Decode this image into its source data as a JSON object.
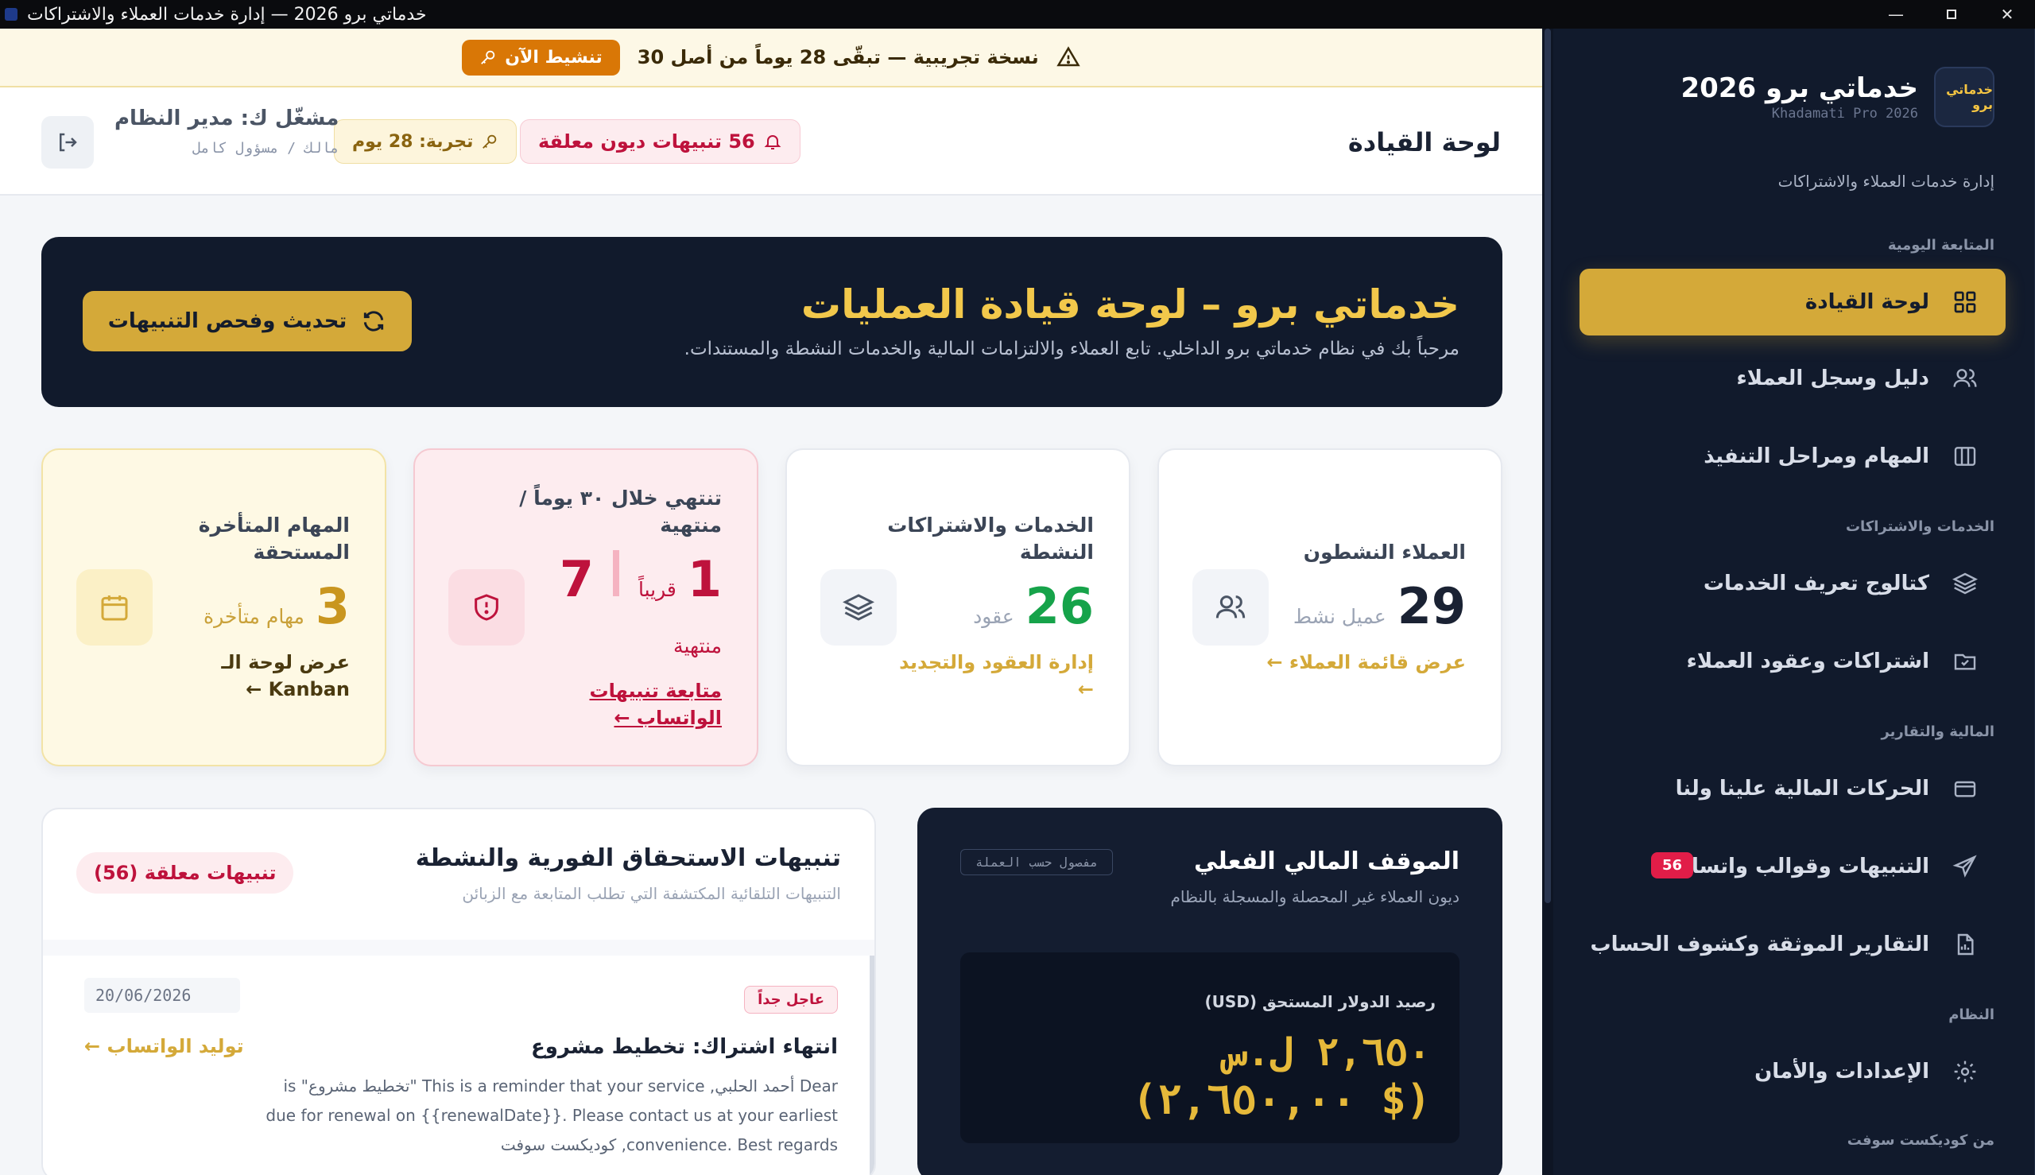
{
  "window": {
    "title": "خدماتي برو 2026 — إدارة خدمات العملاء والاشتراكات",
    "minimize": "—",
    "close": "✕"
  },
  "trial_banner": {
    "text": "نسخة تجريبية — تبقّى 28 يوماً من أصل 30",
    "button": "تنشيط الآن"
  },
  "header": {
    "page_title": "لوحة القيادة",
    "alerts_pill": "56 تنبيهات ديون معلقة",
    "trial_pill": "تجربة: 28 يوم",
    "user_name": "مشغّل ك: مدير النظام",
    "user_role": "مالك / مسؤول كامل"
  },
  "sidebar": {
    "brand_name": "خدماتي برو 2026",
    "brand_en": "Khadamati Pro 2026",
    "brand_logo_text": "خدماتي برو",
    "brand_sub": "إدارة خدمات العملاء والاشتراكات",
    "sections": {
      "daily": "المتابعة اليومية",
      "services": "الخدمات والاشتراكات",
      "finance": "المالية والتقارير",
      "system": "النظام",
      "vendor": "من كوديكست سوفت"
    },
    "items": {
      "dashboard": "لوحة القيادة",
      "customers": "دليل وسجل العملاء",
      "tasks": "المهام ومراحل التنفيذ",
      "catalog": "كتالوج تعريف الخدمات",
      "subscriptions": "اشتراكات وعقود العملاء",
      "transactions": "الحركات المالية علينا ولنا",
      "notifications": "التنبيهات وقوالب واتساب",
      "notifications_badge": "56",
      "reports": "التقارير الموثقة وكشوف الحساب",
      "settings": "الإعدادات والأمان"
    }
  },
  "hero": {
    "title": "خدماتي برو – لوحة قيادة العمليات",
    "subtitle": "مرحباً بك في نظام خدماتي برو الداخلي. تابع العملاء والالتزامات المالية والخدمات النشطة والمستندات.",
    "refresh_button": "تحديث وفحص التنبيهات"
  },
  "stats": {
    "active_customers": {
      "title": "العملاء النشطون",
      "value": "29",
      "unit": "عميل نشط",
      "link": "عرض قائمة العملاء ←"
    },
    "active_services": {
      "title": "الخدمات والاشتراكات النشطة",
      "value": "26",
      "unit": "عقود",
      "link": "إدارة العقود والتجديد ←"
    },
    "expiring": {
      "title": "تنتهي خلال ٣٠ يوماً / منتهية",
      "soon_value": "1",
      "soon_label": "قريباً",
      "expired_value": "7",
      "expired_label": "منتهية",
      "link": "متابعة تنبيهات الواتساب ←"
    },
    "overdue_tasks": {
      "title": "المهام المتأخرة المستحقة",
      "value": "3",
      "unit": "مهام متأخرة",
      "link": "عرض لوحة الـ Kanban ←"
    }
  },
  "finance": {
    "title": "الموقف المالي الفعلي",
    "subtitle": "ديون العملاء غير المحصلة والمسجلة بالنظام",
    "tag": "مفصول حسب العملة",
    "label": "رصيد الدولار المستحق (USD)",
    "value_main": "٢,٦٥٠ ل.س",
    "value_usd": "($ ٢,٦٥٠,٠٠)"
  },
  "alerts": {
    "title": "تنبيهات الاستحقاق الفورية والنشطة",
    "subtitle": "التنبيهات التلقائية المكتشفة التي تطلب المتابعة مع الزبائن",
    "pending_pill": "تنبيهات معلقة (56)",
    "item": {
      "tag": "عاجل جداً",
      "date": "20/06/2026",
      "name": "انتهاء اشتراك: تخطيط مشروع",
      "whatsapp_link": "توليد الواتساب ←",
      "body": "Dear أحمد الحلبي, This is a reminder that your service \"تخطيط مشروع\" is due for renewal on {{renewalDate}}. Please contact us at your earliest convenience. Best regards, كوديكست سوفت"
    }
  },
  "colors": {
    "sidebar_bg": "#111a2c",
    "accent_gold": "#d4a939",
    "alert_red": "#be123c",
    "success_green": "#16a34a",
    "trial_orange": "#d97706"
  }
}
